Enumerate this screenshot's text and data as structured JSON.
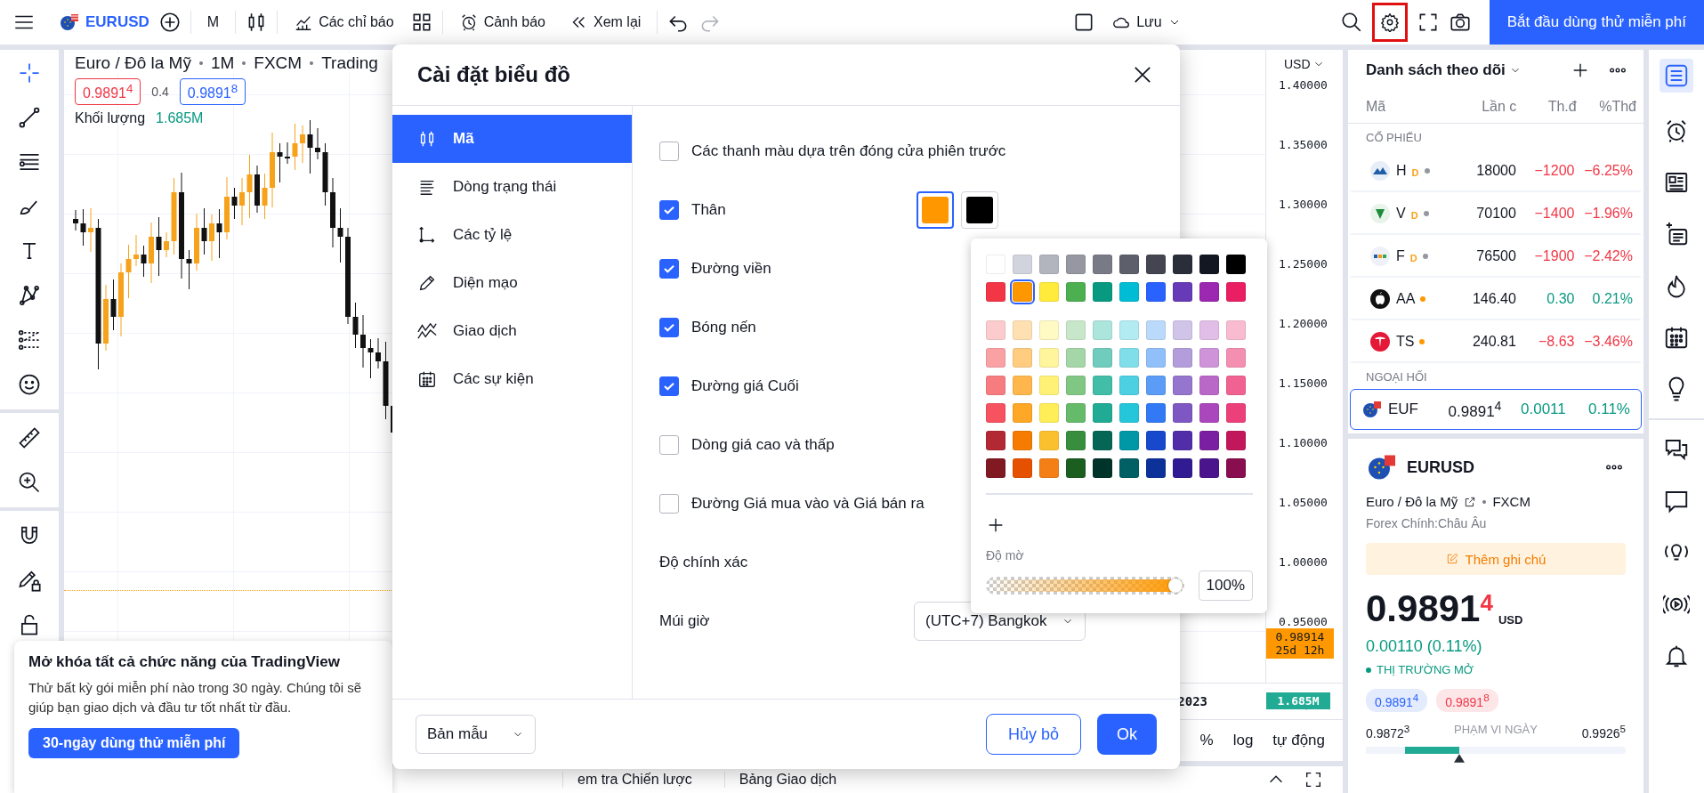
{
  "top_bar": {
    "symbol": "EURUSD",
    "interval": "M",
    "indicators": "Các chỉ báo",
    "alerts": "Cảnh báo",
    "replay": "Xem lại",
    "save": "Lưu",
    "settings_highlighted": true,
    "trial_button": "Bắt đầu dùng thử miễn phí"
  },
  "left_toolbar": [
    {
      "kind": "crosshair",
      "selected": true
    },
    {
      "kind": "trendline",
      "selected": false
    },
    {
      "kind": "hlines",
      "selected": false
    },
    {
      "kind": "brush",
      "selected": false
    },
    {
      "kind": "text",
      "selected": false
    },
    {
      "kind": "pattern",
      "selected": false
    },
    {
      "kind": "fib",
      "selected": false
    },
    {
      "kind": "smiley",
      "selected": false
    },
    {
      "kind": "ruler",
      "selected": false
    },
    {
      "kind": "zoom",
      "selected": false
    },
    {
      "kind": "magnet",
      "selected": false
    },
    {
      "kind": "pencil_lock",
      "selected": false
    },
    {
      "kind": "lock",
      "selected": false
    }
  ],
  "chart": {
    "title_parts": [
      "Euro / Đô la Mỹ",
      "1M",
      "FXCM",
      "Trading"
    ],
    "bid": "0.9891$^{4}$",
    "spread": "0.4",
    "ask": "0.9891$^{8}$",
    "volume_label": "Khối lượng",
    "volume_value": "1.685M"
  },
  "price_axis": {
    "currency": "USD",
    "ticks": [
      "1.40000",
      "1.35000",
      "1.30000",
      "1.25000",
      "1.20000",
      "1.15000",
      "1.10000",
      "1.05000",
      "1.00000",
      "0.95000"
    ],
    "last_price": "0.98914",
    "countdown": "25d 12h",
    "volume": "1.685M"
  },
  "time_axis": {
    "label": "2023"
  },
  "scale_buttons": [
    "%",
    "log",
    "tự động"
  ],
  "bottom_tabs": [
    "em tra Chiến lược",
    "Bảng Giao dịch"
  ],
  "promo": {
    "title": "Mở khóa tất cả chức năng của TradingView",
    "body": "Thử bất kỳ gói miễn phí nào trong 30 ngày. Chúng tôi sẽ giúp bạn giao dịch và đầu tư tốt nhất từ đầu.",
    "button": "30-ngày dùng thử miễn phí"
  },
  "dialog": {
    "title": "Cài đặt biểu đồ",
    "sidebar": [
      {
        "label": "Mã",
        "selected": true
      },
      {
        "label": "Dòng trạng thái",
        "selected": false
      },
      {
        "label": "Các tỷ lệ",
        "selected": false
      },
      {
        "label": "Diện mạo",
        "selected": false
      },
      {
        "label": "Giao dịch",
        "selected": false
      },
      {
        "label": "Các sự kiện",
        "selected": false
      }
    ],
    "options": [
      {
        "kind": "checkbox",
        "label": "Các thanh màu dựa trên đóng cửa phiên trước",
        "checked": false
      },
      {
        "kind": "checkbox",
        "label": "Thân",
        "checked": true,
        "swatches": [
          {
            "color": "#ff9800",
            "selected": true
          },
          {
            "color": "#000000",
            "selected": false
          }
        ]
      },
      {
        "kind": "checkbox",
        "label": "Đường viền",
        "checked": true
      },
      {
        "kind": "checkbox",
        "label": "Bóng nến",
        "checked": true
      },
      {
        "kind": "checkbox",
        "label": "Đường giá Cuối",
        "checked": true
      },
      {
        "kind": "checkbox",
        "label": "Dòng giá cao và thấp",
        "checked": false
      },
      {
        "kind": "checkbox",
        "label": "Đường Giá mua vào và Giá bán ra",
        "checked": false
      },
      {
        "kind": "field",
        "label": "Độ chính xác"
      },
      {
        "kind": "field",
        "label": "Múi giờ",
        "value": "(UTC+7) Bangkok"
      }
    ],
    "template": "Bản mẫu",
    "cancel": "Hủy bỏ",
    "ok": "Ok"
  },
  "color_picker": {
    "palette": [
      [
        {
          "color": "#ffffff",
          "selected": false
        },
        {
          "color": "#d1d4dc",
          "selected": false
        },
        {
          "color": "#b2b5be",
          "selected": false
        },
        {
          "color": "#9598a1",
          "selected": false
        },
        {
          "color": "#787b86",
          "selected": false
        },
        {
          "color": "#5d606b",
          "selected": false
        },
        {
          "color": "#434651",
          "selected": false
        },
        {
          "color": "#2a2e39",
          "selected": false
        },
        {
          "color": "#131722",
          "selected": false
        },
        {
          "color": "#000000",
          "selected": false
        }
      ],
      [
        {
          "color": "#f23645",
          "selected": false
        },
        {
          "color": "#ff9800",
          "selected": true
        },
        {
          "color": "#ffeb3b",
          "selected": false
        },
        {
          "color": "#4caf50",
          "selected": false
        },
        {
          "color": "#089981",
          "selected": false
        },
        {
          "color": "#00bcd4",
          "selected": false
        },
        {
          "color": "#2962ff",
          "selected": false
        },
        {
          "color": "#673ab7",
          "selected": false
        },
        {
          "color": "#9c27b0",
          "selected": false
        },
        {
          "color": "#e91e63",
          "selected": false
        }
      ],
      [
        {
          "color": "#fccbcd",
          "selected": false
        },
        {
          "color": "#ffe0b2",
          "selected": false
        },
        {
          "color": "#fff9c4",
          "selected": false
        },
        {
          "color": "#c8e6c9",
          "selected": false
        },
        {
          "color": "#ace5dc",
          "selected": false
        },
        {
          "color": "#b2ebf2",
          "selected": false
        },
        {
          "color": "#bbd9fb",
          "selected": false
        },
        {
          "color": "#d1c4e9",
          "selected": false
        },
        {
          "color": "#e1bee7",
          "selected": false
        },
        {
          "color": "#f8bbd0",
          "selected": false
        }
      ],
      [
        {
          "color": "#faa1a4",
          "selected": false
        },
        {
          "color": "#ffcc80",
          "selected": false
        },
        {
          "color": "#fff59d",
          "selected": false
        },
        {
          "color": "#a5d6a7",
          "selected": false
        },
        {
          "color": "#70ccbd",
          "selected": false
        },
        {
          "color": "#80deea",
          "selected": false
        },
        {
          "color": "#90bff9",
          "selected": false
        },
        {
          "color": "#b39ddb",
          "selected": false
        },
        {
          "color": "#ce93d8",
          "selected": false
        },
        {
          "color": "#f48fb1",
          "selected": false
        }
      ],
      [
        {
          "color": "#f77c80",
          "selected": false
        },
        {
          "color": "#ffb74d",
          "selected": false
        },
        {
          "color": "#fff176",
          "selected": false
        },
        {
          "color": "#81c784",
          "selected": false
        },
        {
          "color": "#42bda8",
          "selected": false
        },
        {
          "color": "#4dd0e1",
          "selected": false
        },
        {
          "color": "#5b9cf6",
          "selected": false
        },
        {
          "color": "#9575cd",
          "selected": false
        },
        {
          "color": "#ba68c8",
          "selected": false
        },
        {
          "color": "#f06292",
          "selected": false
        }
      ],
      [
        {
          "color": "#f7525f",
          "selected": false
        },
        {
          "color": "#ffa726",
          "selected": false
        },
        {
          "color": "#ffee58",
          "selected": false
        },
        {
          "color": "#66bb6a",
          "selected": false
        },
        {
          "color": "#22ab94",
          "selected": false
        },
        {
          "color": "#26c6da",
          "selected": false
        },
        {
          "color": "#3179f5",
          "selected": false
        },
        {
          "color": "#7e57c2",
          "selected": false
        },
        {
          "color": "#ab47bc",
          "selected": false
        },
        {
          "color": "#ec407a",
          "selected": false
        }
      ],
      [
        {
          "color": "#b22833",
          "selected": false
        },
        {
          "color": "#f57c00",
          "selected": false
        },
        {
          "color": "#fbc02d",
          "selected": false
        },
        {
          "color": "#388e3c",
          "selected": false
        },
        {
          "color": "#056656",
          "selected": false
        },
        {
          "color": "#0097a7",
          "selected": false
        },
        {
          "color": "#1848cc",
          "selected": false
        },
        {
          "color": "#512da8",
          "selected": false
        },
        {
          "color": "#7b1fa2",
          "selected": false
        },
        {
          "color": "#c2185b",
          "selected": false
        }
      ],
      [
        {
          "color": "#801922",
          "selected": false
        },
        {
          "color": "#e65100",
          "selected": false
        },
        {
          "color": "#f57f17",
          "selected": false
        },
        {
          "color": "#1b5e20",
          "selected": false
        },
        {
          "color": "#00332a",
          "selected": false
        },
        {
          "color": "#006064",
          "selected": false
        },
        {
          "color": "#0c3299",
          "selected": false
        },
        {
          "color": "#311b92",
          "selected": false
        },
        {
          "color": "#4a148c",
          "selected": false
        },
        {
          "color": "#880e4f",
          "selected": false
        }
      ]
    ],
    "opacity_label": "Độ mờ",
    "level": 1,
    "opacity_value": "100%"
  },
  "watchlist": {
    "title": "Danh sách theo dõi",
    "columns": [
      "Mã",
      "Lần c",
      "Th.đ",
      "%Thđ"
    ],
    "sections": [
      {
        "title": "CỔ PHIẾU",
        "rows": [
          {
            "symbol": "H",
            "badge": "D",
            "color": "#9598a1",
            "last": "18000",
            "change": "−1200",
            "change_pct": "−6.25%",
            "positive": false,
            "selected": false
          },
          {
            "symbol": "V",
            "badge": "D",
            "color": "#9598a1",
            "last": "70100",
            "change": "−1400",
            "change_pct": "−1.96%",
            "positive": false,
            "selected": false
          },
          {
            "symbol": "F",
            "badge": "D",
            "color": "#9598a1",
            "last": "76500",
            "change": "−1900",
            "change_pct": "−2.42%",
            "positive": false,
            "selected": false
          },
          {
            "symbol": "AA",
            "color": "#ff9800",
            "last": "146.40",
            "change": "0.30",
            "change_pct": "0.21%",
            "positive": true,
            "selected": false
          },
          {
            "symbol": "TS",
            "color": "#ff9800",
            "last": "240.81",
            "change": "−8.63",
            "change_pct": "−3.46%",
            "positive": false,
            "selected": false
          }
        ]
      },
      {
        "title": "NGOẠI HỐI",
        "rows": [
          {
            "symbol": "EUF",
            "last": "0.9891$^{4}$",
            "change": "0.0011",
            "change_pct": "0.11%",
            "positive": true,
            "selected": true
          }
        ]
      }
    ]
  },
  "details": {
    "symbol": "EURUSD",
    "description": "Euro / Đô la Mỹ",
    "exchange": "FXCM",
    "category": "Forex Chính:Châu Âu",
    "note_button": "Thêm ghi chú",
    "price": "0.9891",
    "price_last_digit": "4",
    "currency": "USD",
    "change": "0.00110 (0.11%)",
    "status": "THỊ TRƯỜNG MỞ",
    "bid": "0.9891$^{4}$",
    "ask": "0.9891$^{8}$",
    "range_low": "0.9872$^{3}$",
    "range_label": "PHẠM VI NGÀY",
    "range_high": "0.9926$^{5}$",
    "range": {
      "level": 0.36
    }
  },
  "right_toolbar": [
    {
      "kind": "list",
      "selected": true
    },
    {
      "kind": "alarm",
      "selected": false
    },
    {
      "kind": "news",
      "selected": false
    },
    {
      "kind": "news_plus",
      "selected": false
    },
    {
      "kind": "flame",
      "selected": false
    },
    {
      "kind": "calendar",
      "selected": false
    },
    {
      "kind": "bulb",
      "selected": false
    },
    {
      "kind": "chats",
      "selected": false
    },
    {
      "kind": "chat",
      "selected": false
    },
    {
      "kind": "bulb_signal",
      "selected": false
    },
    {
      "kind": "play_signal",
      "selected": false
    },
    {
      "kind": "bell",
      "selected": false
    }
  ]
}
